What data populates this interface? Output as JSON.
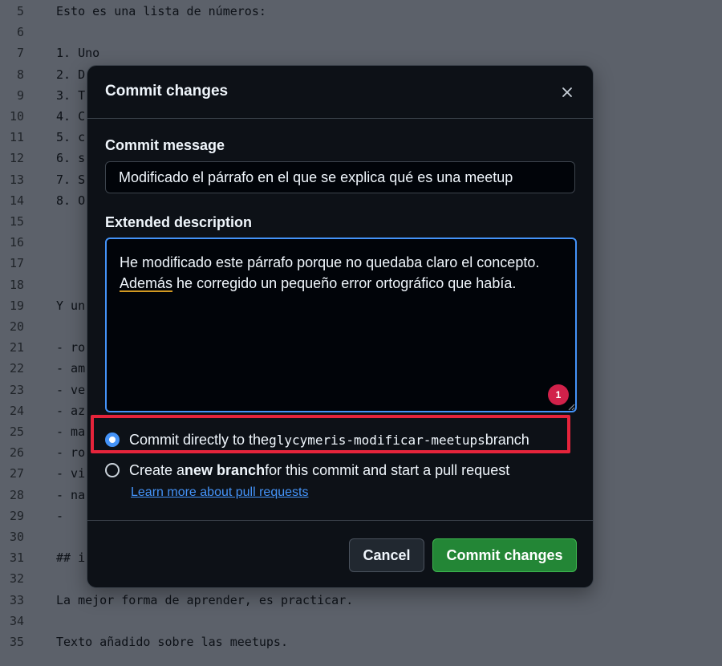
{
  "editor": {
    "lines": [
      {
        "n": "5",
        "text": "Esto es una lista de números:"
      },
      {
        "n": "6",
        "text": ""
      },
      {
        "n": "7",
        "text": "1. Uno"
      },
      {
        "n": "8",
        "text": "2. D"
      },
      {
        "n": "9",
        "text": "3. T"
      },
      {
        "n": "10",
        "text": "4. C"
      },
      {
        "n": "11",
        "text": "5. c"
      },
      {
        "n": "12",
        "text": "6. s"
      },
      {
        "n": "13",
        "text": "7. S"
      },
      {
        "n": "14",
        "text": "8. O"
      },
      {
        "n": "15",
        "text": ""
      },
      {
        "n": "16",
        "text": ""
      },
      {
        "n": "17",
        "text": ""
      },
      {
        "n": "18",
        "text": ""
      },
      {
        "n": "19",
        "text": "Y un"
      },
      {
        "n": "20",
        "text": ""
      },
      {
        "n": "21",
        "text": "- ro"
      },
      {
        "n": "22",
        "text": "- am"
      },
      {
        "n": "23",
        "text": "- ve"
      },
      {
        "n": "24",
        "text": "- az"
      },
      {
        "n": "25",
        "text": "- ma"
      },
      {
        "n": "26",
        "text": "- ro"
      },
      {
        "n": "27",
        "text": "- vi"
      },
      {
        "n": "28",
        "text": "- na"
      },
      {
        "n": "29",
        "text": "-"
      },
      {
        "n": "30",
        "text": ""
      },
      {
        "n": "31",
        "text": "## i"
      },
      {
        "n": "32",
        "text": ""
      },
      {
        "n": "33",
        "text": "La mejor forma de aprender, es practicar."
      },
      {
        "n": "34",
        "text": ""
      },
      {
        "n": "35",
        "text": "Texto añadido sobre las meetups."
      }
    ]
  },
  "modal": {
    "title": "Commit changes",
    "commit_message_label": "Commit message",
    "commit_message_value": "Modificado el párrafo en el que se explica qué es una meetup",
    "extended_description_label": "Extended description",
    "description_part1": "He modificado este párrafo porque no quedaba claro el concepto. ",
    "description_misspelled": "Además",
    "description_part2": " he corregido un pequeño error ortográfico que había.",
    "badge_count": "1",
    "option_direct_prefix": "Commit directly to the ",
    "option_direct_branch": "glycymeris-modificar-meetups",
    "option_direct_suffix": " branch",
    "option_new_prefix": "Create a ",
    "option_new_bold": "new branch",
    "option_new_suffix": " for this commit and start a pull request",
    "learn_more_link": "Learn more about pull requests",
    "cancel_label": "Cancel",
    "commit_label": "Commit changes"
  },
  "colors": {
    "accent": "#4493f8",
    "primary_button": "#238636",
    "highlight_box": "#e5243b",
    "badge": "#d1214a"
  }
}
